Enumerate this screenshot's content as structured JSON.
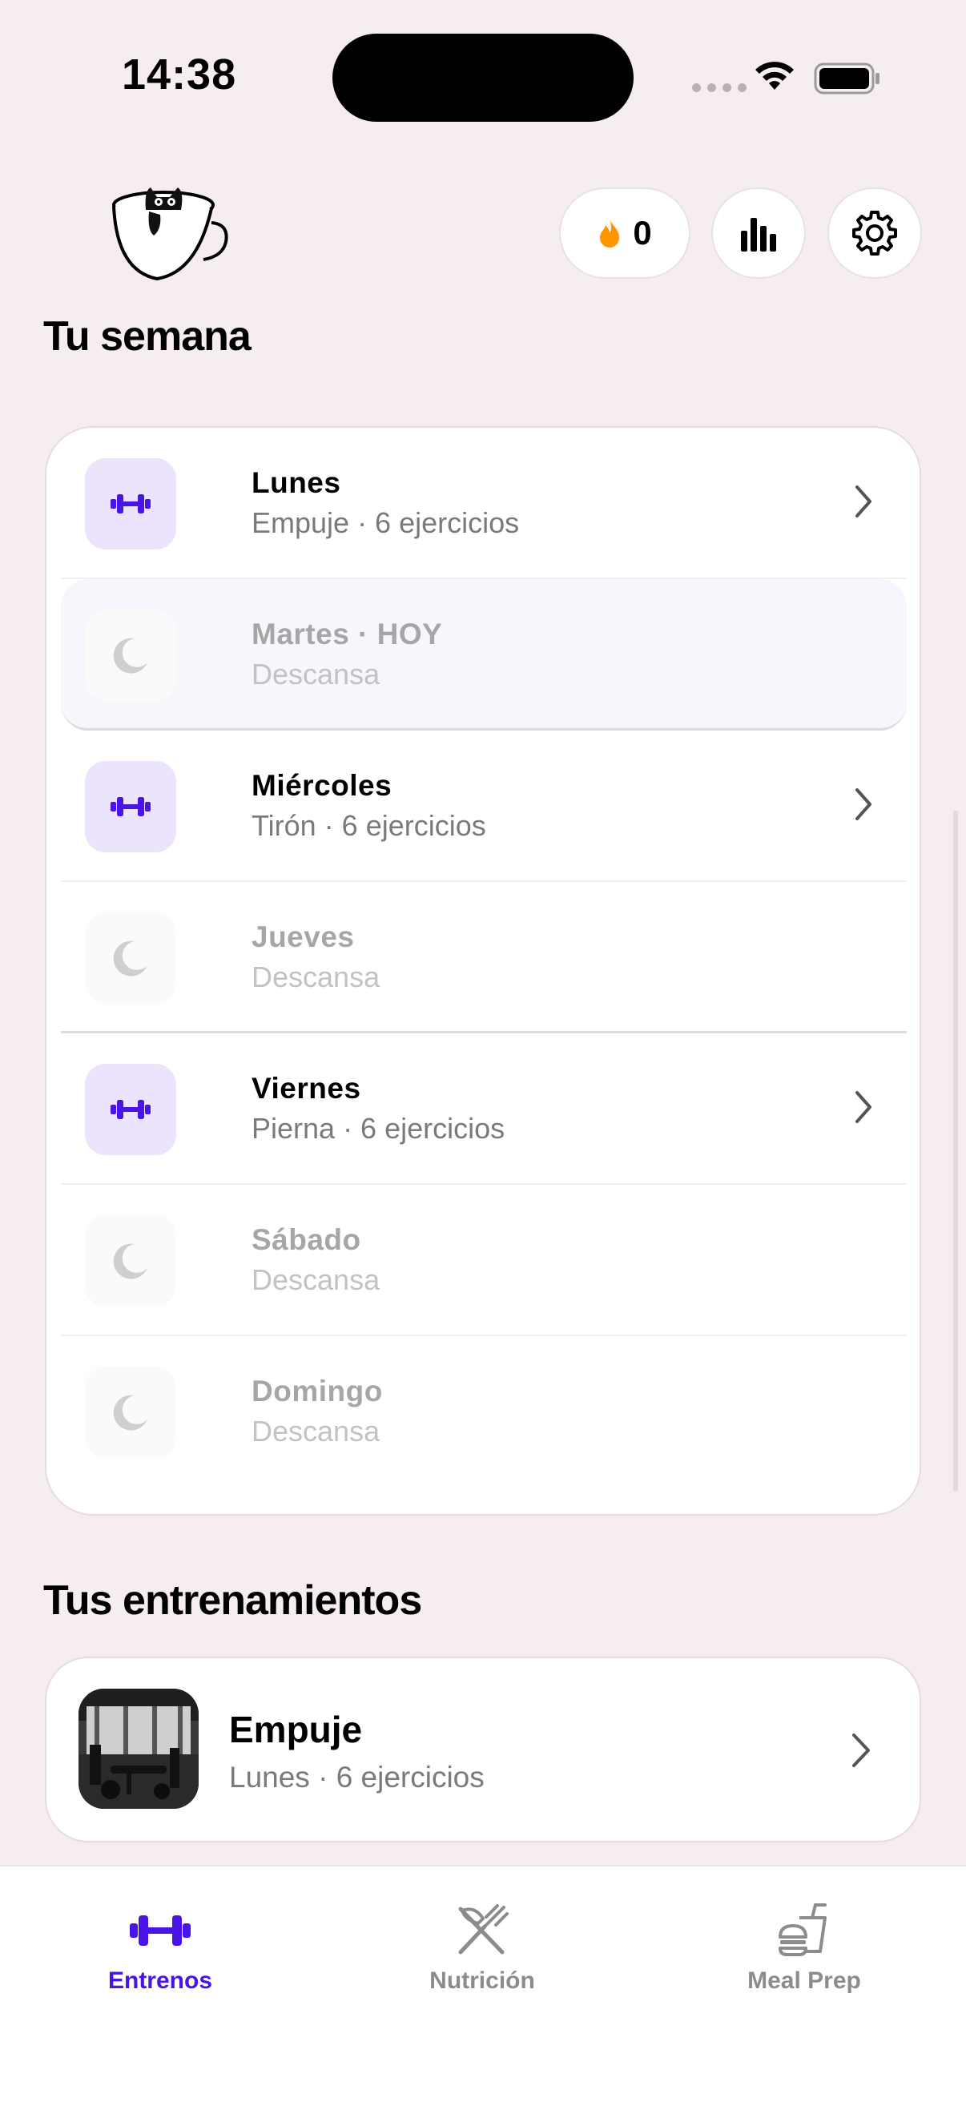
{
  "status_bar": {
    "time": "14:38"
  },
  "header": {
    "streak_count": "0"
  },
  "week": {
    "title": "Tu semana",
    "days": [
      {
        "name": "Lunes",
        "subtitle": "Empuje · 6 ejercicios"
      },
      {
        "name": "Martes · HOY",
        "subtitle": "Descansa"
      },
      {
        "name": "Miércoles",
        "subtitle": "Tirón · 6 ejercicios"
      },
      {
        "name": "Jueves",
        "subtitle": "Descansa"
      },
      {
        "name": "Viernes",
        "subtitle": "Pierna · 6 ejercicios"
      },
      {
        "name": "Sábado",
        "subtitle": "Descansa"
      },
      {
        "name": "Domingo",
        "subtitle": "Descansa"
      }
    ]
  },
  "workouts": {
    "title": "Tus entrenamientos",
    "items": [
      {
        "name": "Empuje",
        "subtitle": "Lunes · 6 ejercicios"
      }
    ]
  },
  "tab_bar": {
    "tabs": [
      {
        "label": "Entrenos",
        "icon": "dumbbell-icon"
      },
      {
        "label": "Nutrición",
        "icon": "fork-knife-icon"
      },
      {
        "label": "Meal Prep",
        "icon": "meal-prep-icon"
      }
    ],
    "active_index": 0
  },
  "colors": {
    "accent": "#4a14e6",
    "accent_soft": "#ece3fc",
    "background": "#f6eeee",
    "streak_flame": "#ff9500"
  }
}
